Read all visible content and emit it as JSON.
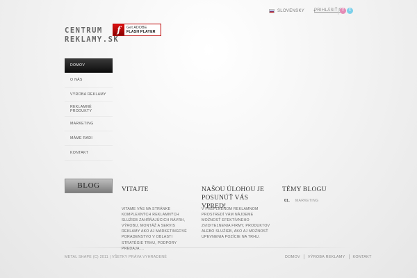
{
  "top": {
    "language": "SLOVENSKY",
    "login": "PRIHLÁSIŤ SA",
    "social": {
      "facebook": "f",
      "twitter": "t"
    }
  },
  "logo": {
    "line1": "CENTRUM",
    "line2": "REKLAMY.SK"
  },
  "flash_badge": {
    "line1": "Get ADOBE",
    "line2": "FLASH PLAYER",
    "icon": "f"
  },
  "nav": {
    "items": [
      {
        "label": "DOMOV"
      },
      {
        "label": "O NÁS"
      },
      {
        "label": "VÝROBA REKLAMY"
      },
      {
        "label": "REKLAMNÉ PRODUKTY"
      },
      {
        "label": "MARKETING"
      },
      {
        "label": "MÁME RADI"
      },
      {
        "label": "KONTAKT"
      }
    ]
  },
  "blog_button": "BLOG",
  "columns": {
    "welcome": {
      "title": "VITAJTE",
      "body": "VITAME VÁS NA STRÁNKE KOMPLEXNÝCH REKLAMNÝCH SLUŽIEB ZAHŔŇAJÚCICH NÁVRH, VÝROBU, MONTÁŽ A SERVIS REKLAMY AKO AJ MARKETINGOVÉ PORADENSTVO V OBLASTI STRATÉGIE TRHU, PODPORY PREDAJA ..."
    },
    "mission": {
      "title": "NAŠOU ÚLOHOU JE POSUNÚŤ VÁS VPRED!",
      "body": "V PREPLNENOM REKLAMNOM PROSTREDÍ VÁM NÁJDEME MOŽNOSŤ EFEKTÍVNEHO ZVIDITEĽNENIA FIRMY, PRODUKTOV ALEBO SLUŽIEB, AKO AJ MOŽNOSŤ UPEVNENIA POZÍCIE NA TRHU."
    },
    "topics": {
      "title": "TÉMY BLOGU",
      "items": [
        {
          "num": "01.",
          "label": "MARKETING"
        }
      ]
    }
  },
  "footer": {
    "copyright": "METAL SHAPE (C) 2011 | VŠETKY PRÁVA VYHRADENÉ",
    "links": [
      "DOMOV",
      "VÝROBA REKLAMY",
      "KONTAKT"
    ]
  }
}
